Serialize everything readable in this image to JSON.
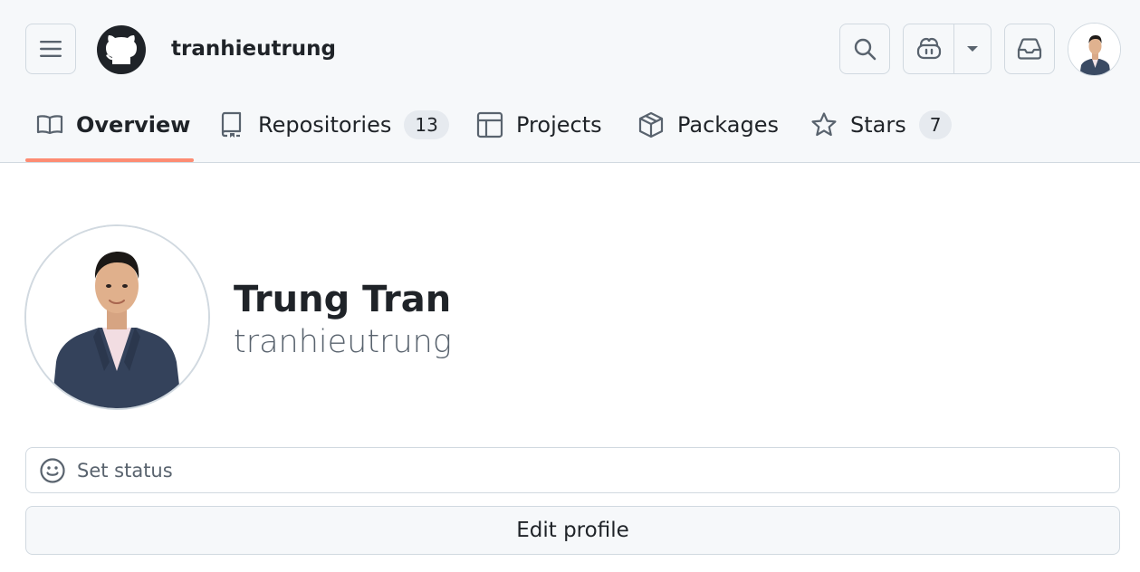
{
  "header": {
    "username": "tranhieutrung",
    "icons": {
      "menu": "hamburger-icon",
      "logo": "github-logo-icon",
      "search": "search-icon",
      "copilot": "copilot-icon",
      "copilot_dropdown": "triangle-down-icon",
      "inbox": "inbox-icon",
      "avatar": "user-avatar"
    }
  },
  "tabs": [
    {
      "label": "Overview",
      "icon": "book-icon",
      "active": true
    },
    {
      "label": "Repositories",
      "icon": "repo-icon",
      "count": "13"
    },
    {
      "label": "Projects",
      "icon": "table-icon"
    },
    {
      "label": "Packages",
      "icon": "package-icon"
    },
    {
      "label": "Stars",
      "icon": "star-icon",
      "count": "7"
    }
  ],
  "profile": {
    "full_name": "Trung Tran",
    "login": "tranhieutrung",
    "status_placeholder": "Set status",
    "status_icon": "smiley-icon",
    "edit_button": "Edit profile"
  },
  "colors": {
    "header_bg": "#f6f8fa",
    "border": "#d1d9e0",
    "active_underline": "#fd8c73",
    "muted_text": "#59636e",
    "counter_bg": "#e6eaef"
  }
}
